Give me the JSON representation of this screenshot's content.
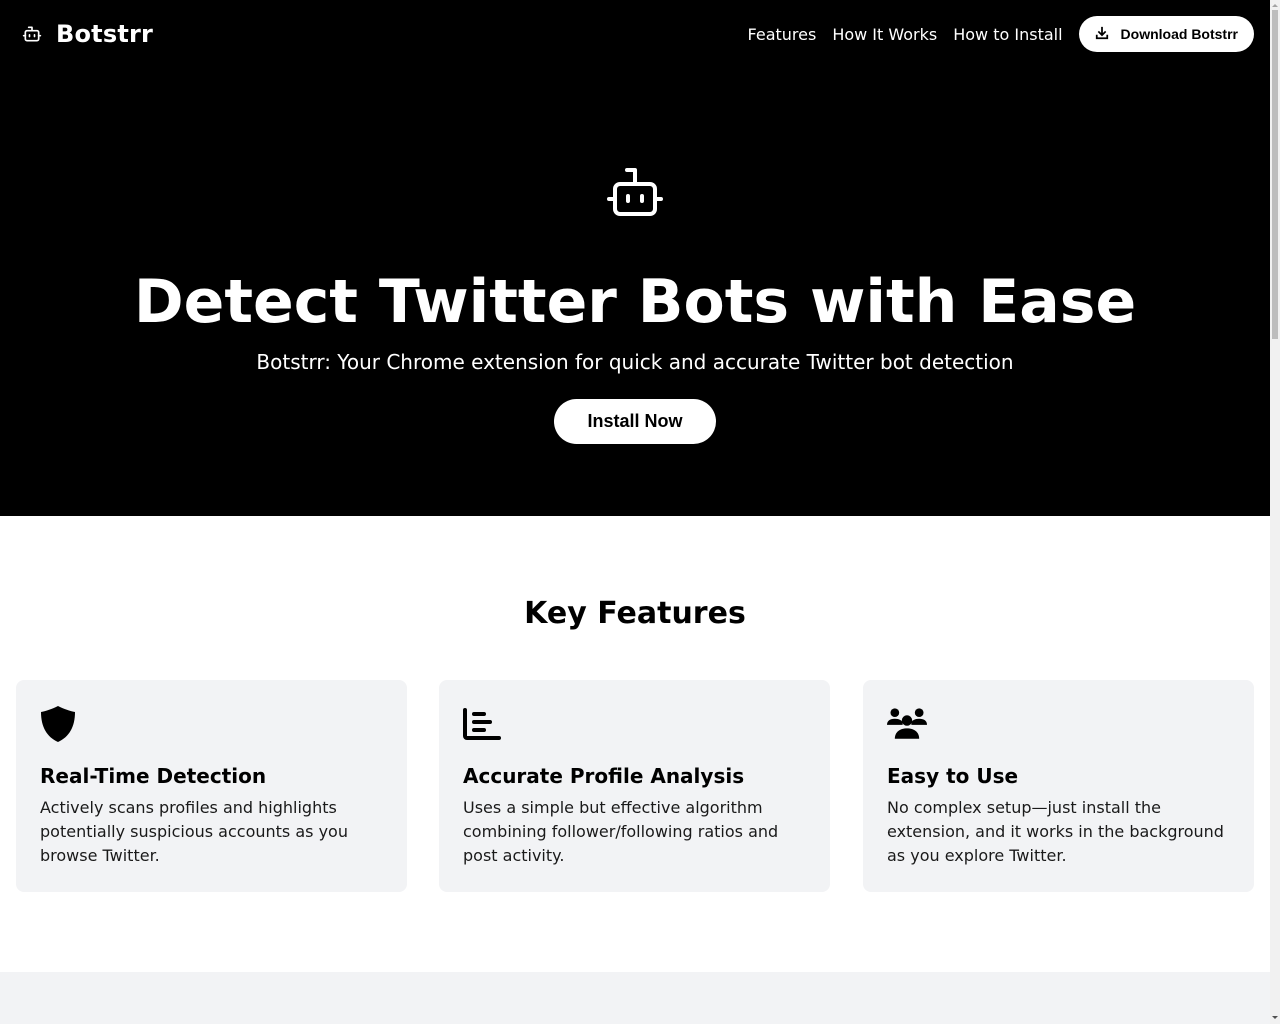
{
  "header": {
    "brand_name": "Botstrr",
    "brand_icon": "robot-icon",
    "nav": [
      {
        "label": "Features"
      },
      {
        "label": "How It Works"
      },
      {
        "label": "How to Install"
      }
    ],
    "download_button": {
      "label": "Download Botstrr",
      "icon": "download-icon"
    }
  },
  "hero": {
    "icon": "robot-icon",
    "title": "Detect Twitter Bots with Ease",
    "subtitle": "Botstrr: Your Chrome extension for quick and accurate Twitter bot detection",
    "cta_label": "Install Now"
  },
  "features": {
    "title": "Key Features",
    "items": [
      {
        "icon": "shield-icon",
        "title": "Real-Time Detection",
        "text": "Actively scans profiles and highlights potentially suspicious accounts as you browse Twitter."
      },
      {
        "icon": "bar-chart-icon",
        "title": "Accurate Profile Analysis",
        "text": "Uses a simple but effective algorithm combining follower/following ratios and post activity."
      },
      {
        "icon": "users-icon",
        "title": "Easy to Use",
        "text": "No complex setup—just install the extension, and it works in the background as you explore Twitter."
      }
    ]
  },
  "colors": {
    "hero_bg": "#000000",
    "card_bg": "#f2f3f5",
    "text": "#000000",
    "button_bg": "#ffffff"
  }
}
